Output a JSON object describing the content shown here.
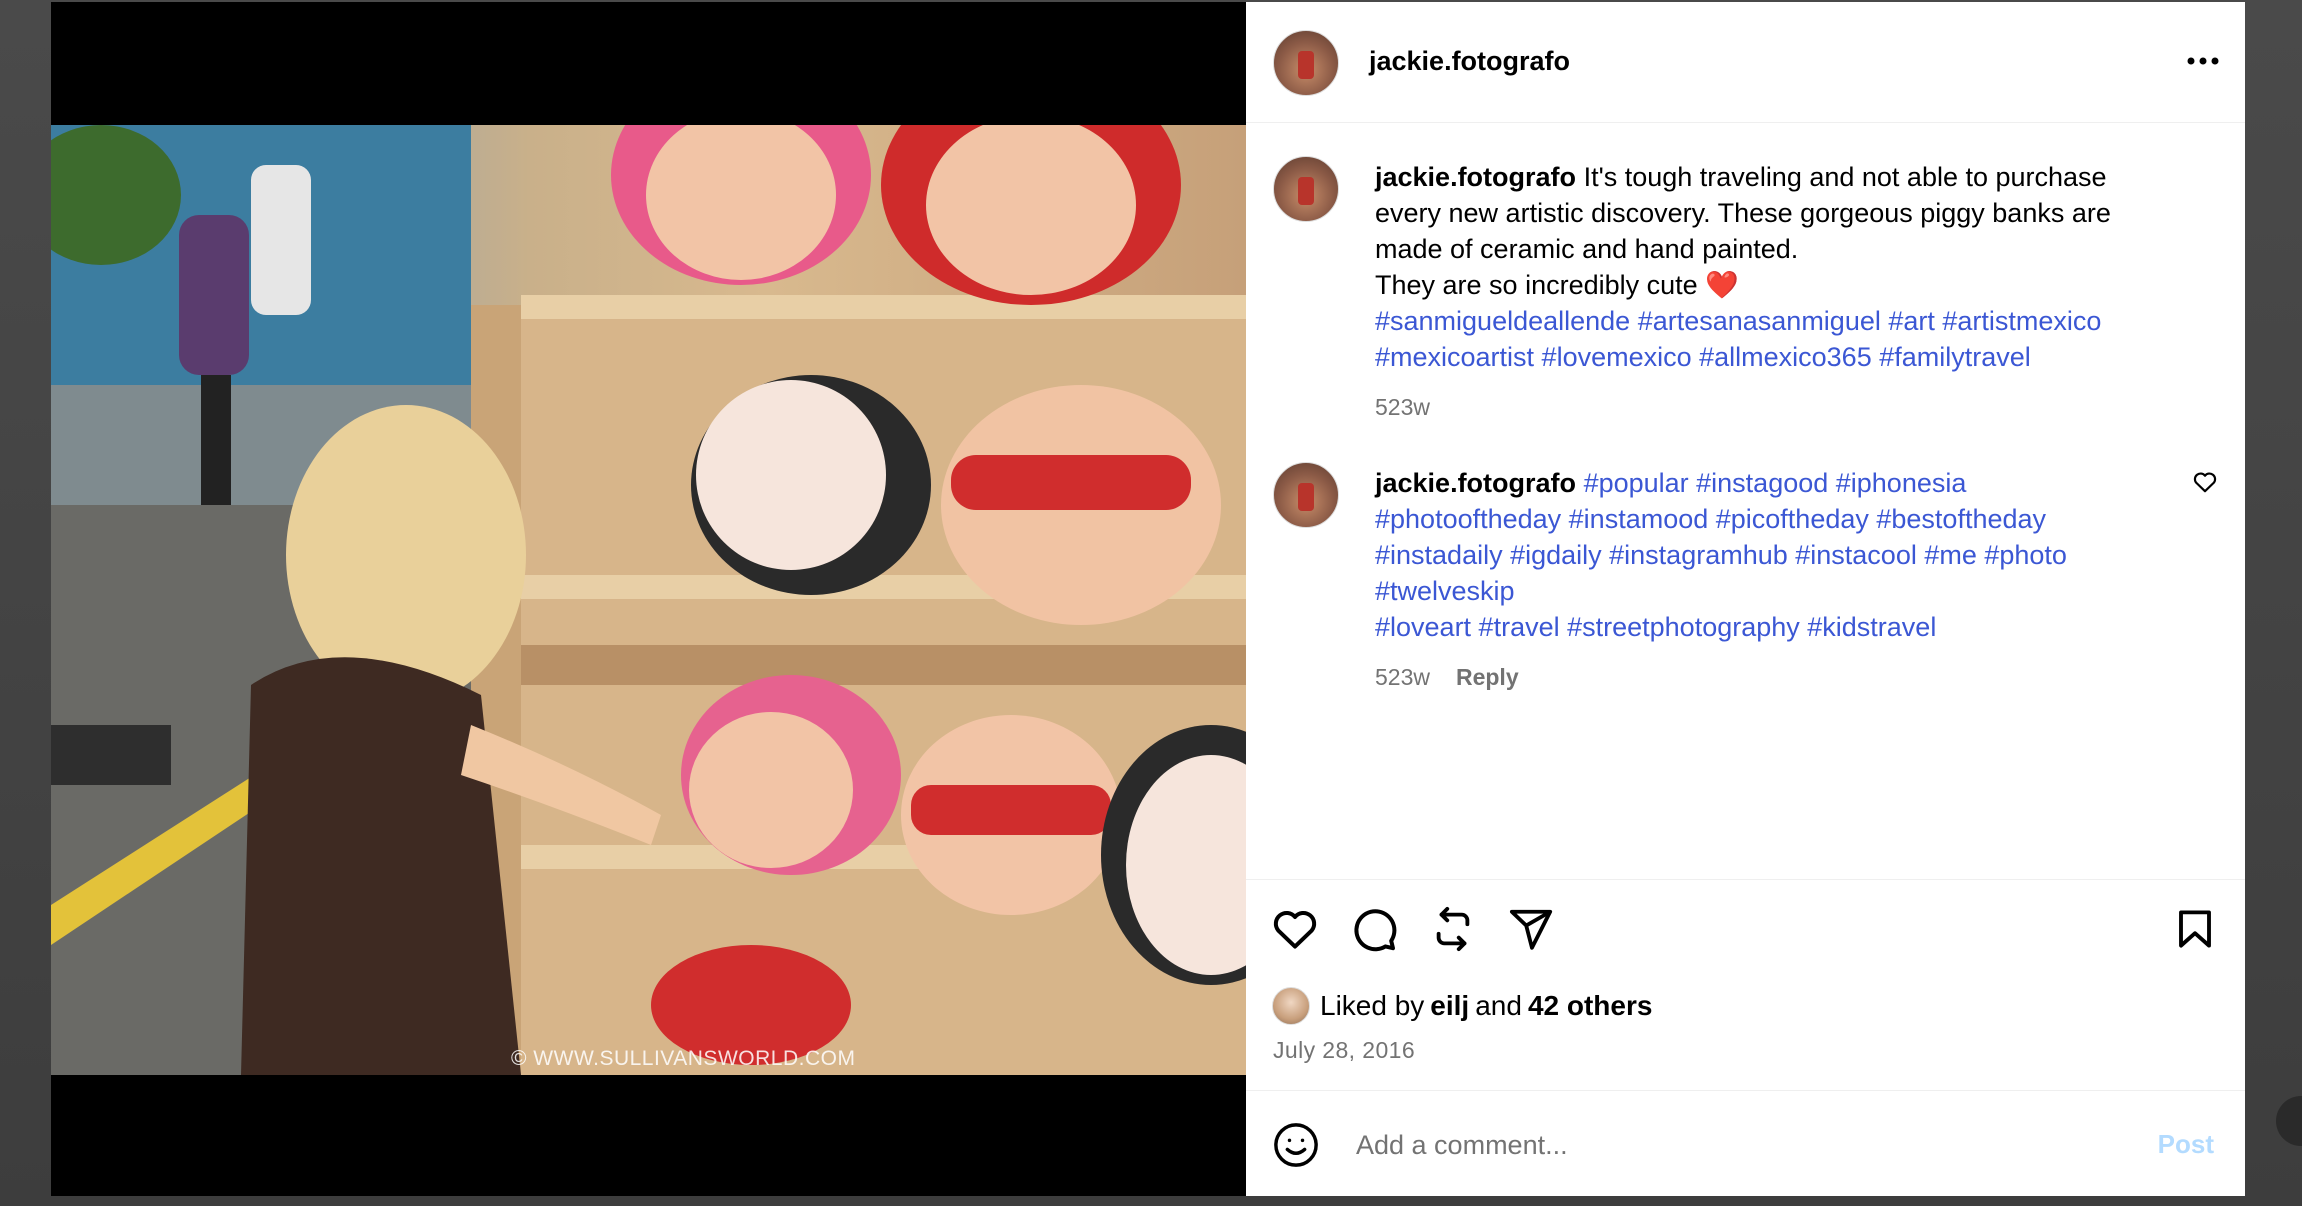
{
  "post": {
    "username": "jackie.fotografo",
    "watermark": "© WWW.SULLIVANSWORLD.COM"
  },
  "comments": [
    {
      "username": "jackie.fotografo",
      "text_line1": "It's tough traveling and not able to purchase",
      "text_line2": "every new artistic discovery. These gorgeous piggy banks are",
      "text_line3": "made of ceramic and hand painted.",
      "text_line4": "They are so incredibly cute ❤️",
      "hashtags_line1": "#sanmigueldeallende #artesanasanmiguel #art #artistmexico",
      "hashtags_line2": "#mexicoartist #lovemexico #allmexico365 #familytravel",
      "time": "523w"
    },
    {
      "username": "jackie.fotografo",
      "hashtags_line1": "#popular #instagood #iphonesia",
      "hashtags_line2": "#photooftheday #instamood #picoftheday #bestoftheday",
      "hashtags_line3": "#instadaily #igdaily #instagramhub #instacool #me #photo",
      "hashtags_line4": "#twelveskip",
      "hashtags_line5": "#loveart #travel #streetphotography #kidstravel",
      "time": "523w",
      "reply_label": "Reply"
    }
  ],
  "likes": {
    "prefix": "Liked by",
    "user": "eilj",
    "and": "and",
    "others": "42 others"
  },
  "date": "July 28, 2016",
  "compose": {
    "placeholder": "Add a comment...",
    "post_label": "Post"
  },
  "colors": {
    "hashtag": "#3b57d4",
    "post_disabled": "#b3dbff",
    "meta": "#737373"
  },
  "icons": {
    "more": "more-horizontal-icon",
    "like": "heart-icon",
    "comment": "comment-bubble-icon",
    "repost": "repost-icon",
    "share": "send-icon",
    "save": "bookmark-icon",
    "emoji": "emoji-smile-icon"
  }
}
